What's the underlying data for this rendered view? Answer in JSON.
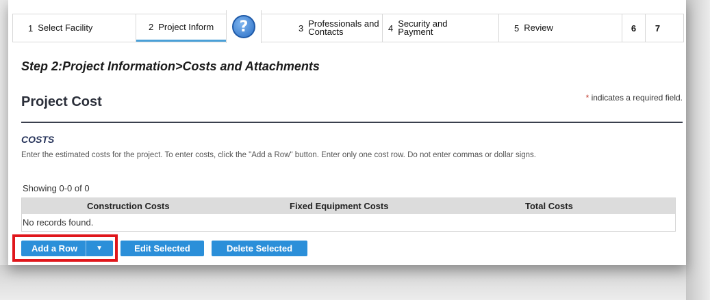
{
  "steps": [
    {
      "num": "1",
      "label": "Select Facility"
    },
    {
      "num": "2",
      "label": "Project Inform"
    },
    {
      "num": "3",
      "label": "Professionals and Contacts"
    },
    {
      "num": "4",
      "label": "Security and Payment"
    },
    {
      "num": "5",
      "label": "Review"
    },
    {
      "num": "6",
      "label": ""
    },
    {
      "num": "7",
      "label": ""
    }
  ],
  "help_icon_glyph": "?",
  "heading": "Step 2:Project Information>Costs and Attachments",
  "required_note": {
    "star": "*",
    "text": "indicates a required field."
  },
  "section_title": "Project Cost",
  "costs": {
    "title": "COSTS",
    "instructions": "Enter the estimated costs for the project. To enter costs, click the \"Add a Row\" button. Enter only one cost row. Do not enter commas or dollar signs.",
    "showing": "Showing 0-0 of 0",
    "columns": [
      "Construction Costs",
      "Fixed Equipment Costs",
      "Total Costs"
    ],
    "empty_text": "No records found."
  },
  "buttons": {
    "add_row": "Add a Row",
    "add_row_caret": "▼",
    "edit_selected": "Edit Selected",
    "delete_selected": "Delete Selected"
  },
  "colors": {
    "button_blue": "#2b8fd9",
    "highlight_red": "#e0161b",
    "active_tab_underline": "#4aa0d8"
  }
}
